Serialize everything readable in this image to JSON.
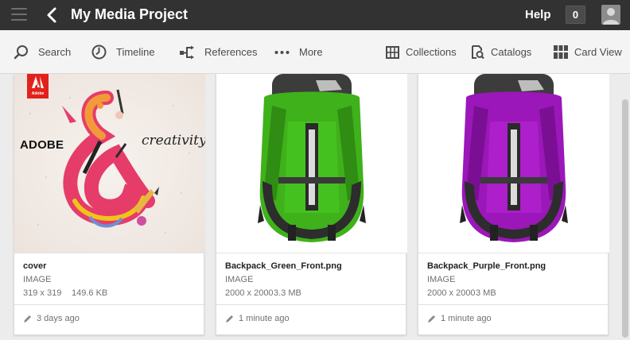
{
  "header": {
    "title": "My Media Project",
    "help_label": "Help",
    "notification_count": "0"
  },
  "toolbar": {
    "search_label": "Search",
    "timeline_label": "Timeline",
    "references_label": "References",
    "more_label": "More",
    "collections_label": "Collections",
    "catalogs_label": "Catalogs",
    "cardview_label": "Card View"
  },
  "assets": [
    {
      "name": "cover",
      "type": "IMAGE",
      "dimensions": "319 x 319",
      "size": "149.6 KB",
      "modified": "3 days ago",
      "art": {
        "brand": "ADOBE",
        "word": "creativity",
        "logo_text": "Adobe"
      }
    },
    {
      "name": "Backpack_Green_Front.png",
      "type": "IMAGE",
      "dimensions": "2000 x 2000",
      "size": "3.3 MB",
      "modified": "1 minute ago",
      "color": "#3fb11b"
    },
    {
      "name": "Backpack_Purple_Front.png",
      "type": "IMAGE",
      "dimensions": "2000 x 2000",
      "size": "3 MB",
      "modified": "1 minute ago",
      "color": "#9b17b9"
    }
  ],
  "colors": {
    "header_bg": "#323232",
    "toolbar_bg": "#f4f4f4",
    "content_bg": "#ececec"
  }
}
